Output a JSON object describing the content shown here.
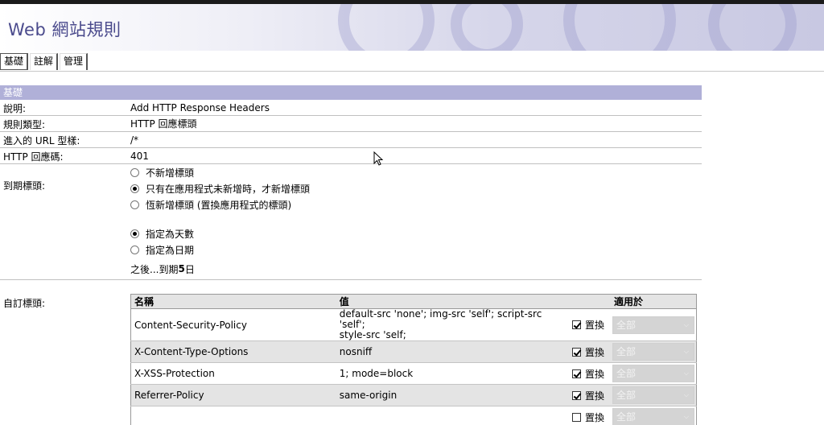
{
  "banner": {
    "title": "Web 網站規則"
  },
  "tabs": [
    {
      "label": "基礎",
      "active": true
    },
    {
      "label": "註解",
      "active": false
    },
    {
      "label": "管理",
      "active": false
    }
  ],
  "section": {
    "header": "基礎",
    "fields": {
      "description": {
        "label": "說明:",
        "value": "Add HTTP Response Headers"
      },
      "rule_type": {
        "label": "規則類型:",
        "value": "HTTP 回應標頭"
      },
      "url_pattern": {
        "label": "進入的 URL 型樣:",
        "value": "/*"
      },
      "response_code": {
        "label": "HTTP 回應碼:",
        "value": "401"
      }
    },
    "expiry": {
      "label": "到期標頭:",
      "header_options": [
        {
          "label": "不新增標頭",
          "selected": false
        },
        {
          "label": "只有在應用程式未新增時，才新增標頭",
          "selected": true
        },
        {
          "label": "恆新增標頭 (置換應用程式的標頭)",
          "selected": false
        }
      ],
      "mode_options": [
        {
          "label": "指定為天數",
          "selected": true
        },
        {
          "label": "指定為日期",
          "selected": false
        }
      ],
      "after_prefix": "之後...到期",
      "after_days": "5",
      "after_suffix": "日"
    },
    "custom_headers": {
      "label": "自訂標頭:",
      "columns": {
        "name": "名稱",
        "value": "值",
        "replace": "",
        "applies": "適用於"
      },
      "replace_label": "置換",
      "applies_placeholder": "全部",
      "rows": [
        {
          "name": "Content-Security-Policy",
          "value_line1": "default-src 'none'; img-src 'self'; script-src 'self';",
          "value_line2": "style-src 'self;",
          "replace": true,
          "applies": "全部",
          "shaded": false
        },
        {
          "name": "X-Content-Type-Options",
          "value_line1": "nosniff",
          "value_line2": "",
          "replace": true,
          "applies": "全部",
          "shaded": true
        },
        {
          "name": "X-XSS-Protection",
          "value_line1": "1; mode=block",
          "value_line2": "",
          "replace": true,
          "applies": "全部",
          "shaded": false
        },
        {
          "name": "Referrer-Policy",
          "value_line1": "same-origin",
          "value_line2": "",
          "replace": true,
          "applies": "全部",
          "shaded": true
        },
        {
          "name": "",
          "value_line1": "",
          "value_line2": "",
          "replace": false,
          "applies": "全部",
          "shaded": false
        }
      ]
    }
  },
  "colors": {
    "banner_text": "#4a4a8c",
    "section_header_bg": "#b0b0d8",
    "row_shade": "#e4e4e4"
  }
}
